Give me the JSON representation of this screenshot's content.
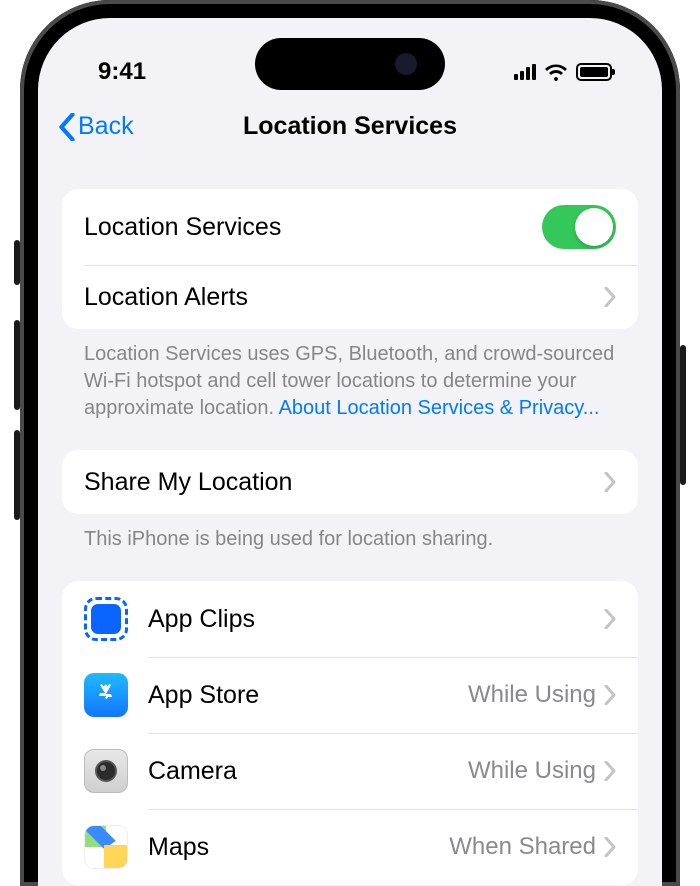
{
  "statusBar": {
    "time": "9:41"
  },
  "nav": {
    "back": "Back",
    "title": "Location Services"
  },
  "group1": {
    "locationServices": {
      "label": "Location Services",
      "enabled": true
    },
    "locationAlerts": {
      "label": "Location Alerts"
    },
    "footer": "Location Services uses GPS, Bluetooth, and crowd-sourced Wi-Fi hotspot and cell tower locations to determine your approximate location. ",
    "footerLink": "About Location Services & Privacy..."
  },
  "group2": {
    "shareMyLocation": {
      "label": "Share My Location"
    },
    "footer": "This iPhone is being used for location sharing."
  },
  "apps": [
    {
      "name": "App Clips",
      "value": ""
    },
    {
      "name": "App Store",
      "value": "While Using"
    },
    {
      "name": "Camera",
      "value": "While Using"
    },
    {
      "name": "Maps",
      "value": "When Shared"
    }
  ]
}
